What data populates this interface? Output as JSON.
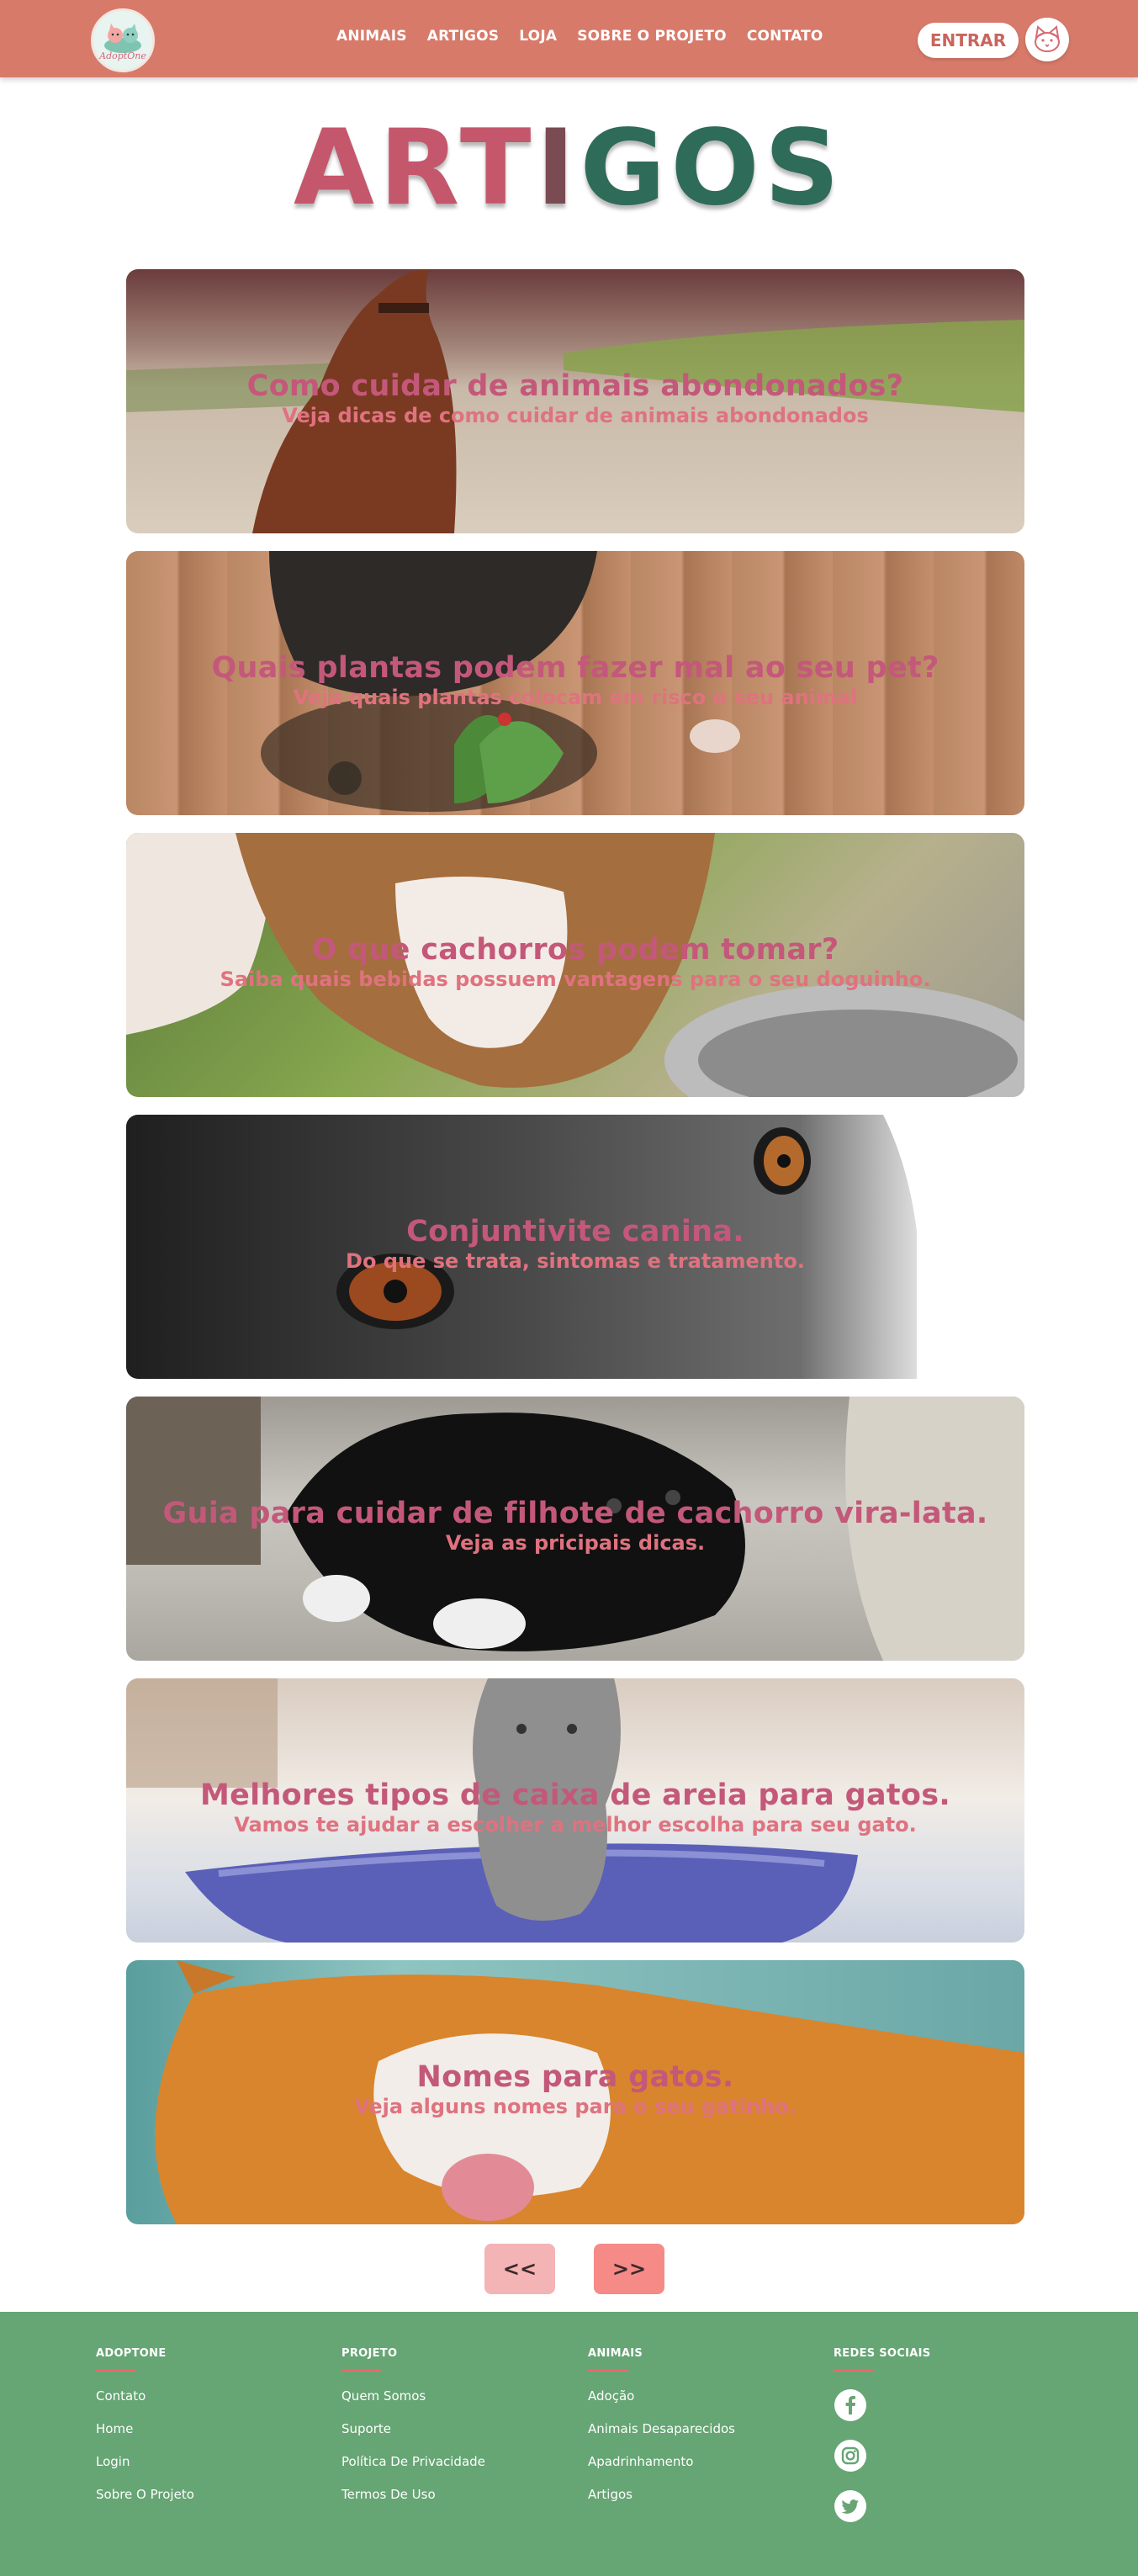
{
  "header": {
    "logo_text": "AdoptOne",
    "nav": [
      "ANIMAIS",
      "ARTIGOS",
      "LOJA",
      "SOBRE O PROJETO",
      "CONTATO"
    ],
    "enter_label": "ENTRAR",
    "avatar_icon": "cat-face-icon"
  },
  "title": {
    "part1": "ART",
    "part2": "I",
    "part3": "GOS"
  },
  "articles": [
    {
      "title": "Como cuidar de animais abondonados?",
      "subtitle": "Veja dicas de como cuidar de animais abondonados"
    },
    {
      "title": "Quais plantas podem fazer mal ao seu pet?",
      "subtitle": "Veja quais plantas colocam em risco o seu animal"
    },
    {
      "title": "O que cachorros podem tomar?",
      "subtitle": "Saiba quais bebidas possuem vantagens para o seu doguinho."
    },
    {
      "title": "Conjuntivite canina.",
      "subtitle": "Do que se trata, sintomas e tratamento."
    },
    {
      "title": "Guia para cuidar de filhote de cachorro vira-lata.",
      "subtitle": "Veja as pricipais dicas."
    },
    {
      "title": "Melhores tipos de caixa de areia para gatos.",
      "subtitle": "Vamos te ajudar a escolher a melhor escolha para seu gato."
    },
    {
      "title": "Nomes para gatos.",
      "subtitle": "Veja alguns nomes para o seu gatinho."
    }
  ],
  "pagination": {
    "prev": "<<",
    "next": ">>"
  },
  "footer": {
    "col1": {
      "heading": "ADOPTONE",
      "links": [
        "Contato",
        "Home",
        "Login",
        "Sobre O Projeto"
      ]
    },
    "col2": {
      "heading": "PROJETO",
      "links": [
        "Quem Somos",
        "Suporte",
        "Política De Privacidade",
        "Termos De Uso"
      ]
    },
    "col3": {
      "heading": "ANIMAIS",
      "links": [
        "Adoção",
        "Animais Desaparecidos",
        "Apadrinhamento",
        "Artigos"
      ]
    },
    "col4": {
      "heading": "REDES SOCIAIS",
      "icons": [
        "facebook-icon",
        "instagram-icon",
        "twitter-icon"
      ]
    }
  },
  "colors": {
    "header_bg": "#d87a6a",
    "footer_bg": "#66a574",
    "card_title": "#c4587a",
    "card_subtitle": "#e0727f",
    "pagination_prev": "#f4b3b4",
    "pagination_next": "#f68a86"
  }
}
